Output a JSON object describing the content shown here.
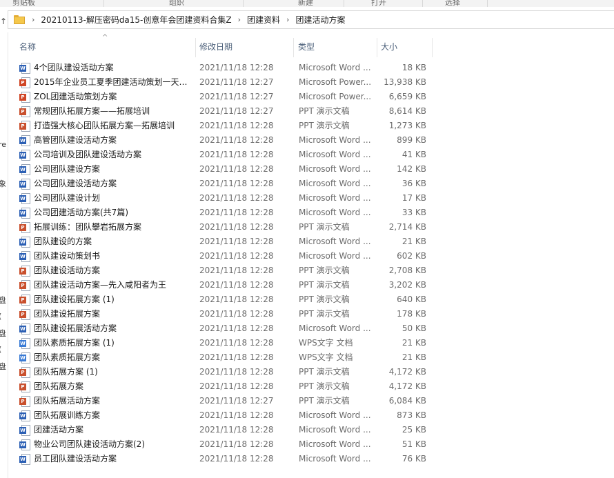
{
  "ribbon": {
    "labels": [
      "剪贴板",
      "组织",
      "新建",
      "打开",
      "选择"
    ]
  },
  "address": {
    "crumbs": [
      "20210113-解压密码da15-创意年会团建资料合集Z",
      "团建资料",
      "团建活动方案"
    ],
    "separator": "›"
  },
  "left_edge_glyphs": [
    "re",
    "象",
    "盘",
    "(",
    "盘",
    "(",
    "盘"
  ],
  "columns": {
    "name": "名称",
    "date": "修改日期",
    "type": "类型",
    "size": "大小"
  },
  "files": [
    {
      "icon": "word",
      "name": "4个团队建设活动方案",
      "date": "2021/11/18 12:28",
      "type": "Microsoft Word ...",
      "size": "18 KB"
    },
    {
      "icon": "ppt",
      "name": "2015年企业员工夏季团建活动策划一天0...",
      "date": "2021/11/18 12:27",
      "type": "Microsoft Power...",
      "size": "13,938 KB"
    },
    {
      "icon": "ppt",
      "name": "ZOL团建活动策划方案",
      "date": "2021/11/18 12:27",
      "type": "Microsoft Power...",
      "size": "6,659 KB"
    },
    {
      "icon": "pptdoc",
      "name": "常规团队拓展方案——拓展培训",
      "date": "2021/11/18 12:27",
      "type": "PPT 演示文稿",
      "size": "8,614 KB"
    },
    {
      "icon": "pptdoc",
      "name": "打造强大核心团队拓展方案—拓展培训",
      "date": "2021/11/18 12:28",
      "type": "PPT 演示文稿",
      "size": "1,273 KB"
    },
    {
      "icon": "word",
      "name": "高管团队建设活动方案",
      "date": "2021/11/18 12:28",
      "type": "Microsoft Word ...",
      "size": "899 KB"
    },
    {
      "icon": "word",
      "name": "公司培训及团队建设活动方案",
      "date": "2021/11/18 12:28",
      "type": "Microsoft Word ...",
      "size": "41 KB"
    },
    {
      "icon": "word",
      "name": "公司团队建设方案",
      "date": "2021/11/18 12:28",
      "type": "Microsoft Word ...",
      "size": "142 KB"
    },
    {
      "icon": "word",
      "name": "公司团队建设活动方案",
      "date": "2021/11/18 12:28",
      "type": "Microsoft Word ...",
      "size": "36 KB"
    },
    {
      "icon": "word",
      "name": "公司团队建设计划",
      "date": "2021/11/18 12:28",
      "type": "Microsoft Word ...",
      "size": "17 KB"
    },
    {
      "icon": "word",
      "name": "公司团建活动方案(共7篇)",
      "date": "2021/11/18 12:28",
      "type": "Microsoft Word ...",
      "size": "33 KB"
    },
    {
      "icon": "pptdoc",
      "name": "拓展训练：团队攀岩拓展方案",
      "date": "2021/11/18 12:28",
      "type": "PPT 演示文稿",
      "size": "2,714 KB"
    },
    {
      "icon": "word",
      "name": "团队建设的方案",
      "date": "2021/11/18 12:28",
      "type": "Microsoft Word ...",
      "size": "21 KB"
    },
    {
      "icon": "word",
      "name": "团队建设动策划书",
      "date": "2021/11/18 12:28",
      "type": "Microsoft Word ...",
      "size": "602 KB"
    },
    {
      "icon": "pptdoc",
      "name": "团队建设活动方案",
      "date": "2021/11/18 12:28",
      "type": "PPT 演示文稿",
      "size": "2,708 KB"
    },
    {
      "icon": "pptdoc",
      "name": "团队建设活动方案—先入咸阳者为王",
      "date": "2021/11/18 12:28",
      "type": "PPT 演示文稿",
      "size": "3,202 KB"
    },
    {
      "icon": "pptdoc",
      "name": "团队建设拓展方案 (1)",
      "date": "2021/11/18 12:28",
      "type": "PPT 演示文稿",
      "size": "640 KB"
    },
    {
      "icon": "pptdoc",
      "name": "团队建设拓展方案",
      "date": "2021/11/18 12:28",
      "type": "PPT 演示文稿",
      "size": "178 KB"
    },
    {
      "icon": "word",
      "name": "团队建设拓展活动方案",
      "date": "2021/11/18 12:28",
      "type": "Microsoft Word ...",
      "size": "50 KB"
    },
    {
      "icon": "wps",
      "name": "团队素质拓展方案 (1)",
      "date": "2021/11/18 12:28",
      "type": "WPS文字 文档",
      "size": "21 KB"
    },
    {
      "icon": "wps",
      "name": "团队素质拓展方案",
      "date": "2021/11/18 12:28",
      "type": "WPS文字 文档",
      "size": "21 KB"
    },
    {
      "icon": "pptdoc",
      "name": "团队拓展方案 (1)",
      "date": "2021/11/18 12:28",
      "type": "PPT 演示文稿",
      "size": "4,172 KB"
    },
    {
      "icon": "pptdoc",
      "name": "团队拓展方案",
      "date": "2021/11/18 12:28",
      "type": "PPT 演示文稿",
      "size": "4,172 KB"
    },
    {
      "icon": "pptdoc",
      "name": "团队拓展活动方案",
      "date": "2021/11/18 12:27",
      "type": "PPT 演示文稿",
      "size": "6,084 KB"
    },
    {
      "icon": "word",
      "name": "团队拓展训练方案",
      "date": "2021/11/18 12:28",
      "type": "Microsoft Word ...",
      "size": "873 KB"
    },
    {
      "icon": "word",
      "name": "团建活动方案",
      "date": "2021/11/18 12:28",
      "type": "Microsoft Word ...",
      "size": "25 KB"
    },
    {
      "icon": "word",
      "name": "物业公司团队建设活动方案(2)",
      "date": "2021/11/18 12:28",
      "type": "Microsoft Word ...",
      "size": "51 KB"
    },
    {
      "icon": "word",
      "name": "员工团队建设活动方案",
      "date": "2021/11/18 12:28",
      "type": "Microsoft Word ...",
      "size": "76 KB"
    }
  ],
  "icon_letters": {
    "word": "W",
    "ppt": "P",
    "pptdoc": "P",
    "wps": "W"
  }
}
